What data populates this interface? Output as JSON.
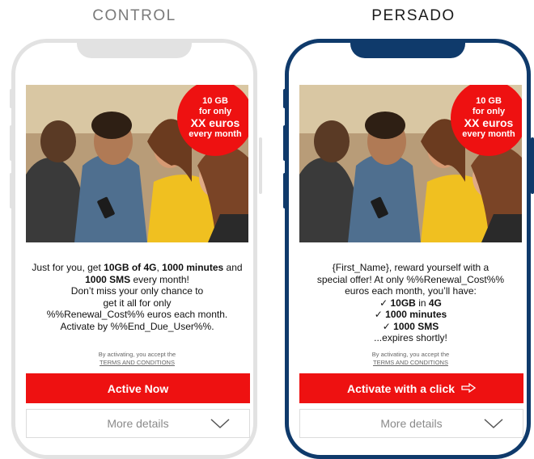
{
  "headings": {
    "control": "CONTROL",
    "persado": "PERSADO"
  },
  "colors": {
    "accent_red": "#ee1111",
    "persado_frame": "#0f3a6b",
    "control_frame": "#e2e2e2"
  },
  "badge": {
    "line1": "10 GB",
    "line2": "for only",
    "line3": "XX euros",
    "line4": "every month"
  },
  "control": {
    "message": {
      "p1": "Just for you, get ",
      "b1": "10GB of 4G",
      "p2": ", ",
      "b2": "1000 minutes",
      "p3": " and ",
      "b3": "1000 SMS",
      "p4": " every month!",
      "line2": "Don’t miss your only chance to",
      "line3": "get it all for only",
      "line4": "%%Renewal_Cost%% euros each month.",
      "line5": "Activate by %%End_Due_User%%."
    },
    "legal": {
      "line1": "By activating, you accept the",
      "terms": "TERMS AND CONDITIONS"
    },
    "cta_label": "Active Now",
    "more_label": "More details"
  },
  "persado": {
    "message": {
      "line1": "{First_Name}, reward yourself with a",
      "line2": "special offer! At only %%Renewal_Cost%%",
      "line3": "euros each month, you’ll have:",
      "check1_bold": "10GB",
      "check1_rest": " in ",
      "check1_bold2": "4G",
      "check2": "1000 minutes",
      "check3": "1000 SMS",
      "line_end": "...expires shortly!"
    },
    "legal": {
      "line1": "By activating, you accept the",
      "terms": "TERMS AND CONDITIONS"
    },
    "cta_label": "Activate with a click",
    "cta_icon": "arrow-right-icon",
    "more_label": "More details"
  },
  "icons": {
    "more": "chevron-down-icon",
    "check": "check-icon"
  }
}
